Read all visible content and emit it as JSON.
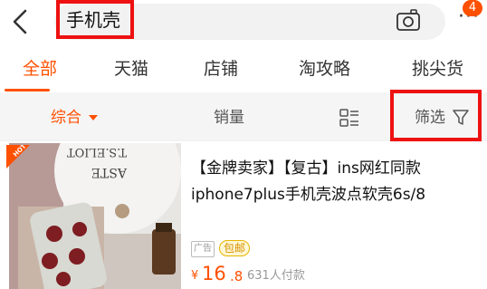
{
  "search": {
    "query": "手机壳"
  },
  "header": {
    "notification_count": "4",
    "more_glyph": "···"
  },
  "tabs": [
    {
      "label": "全部",
      "active": true
    },
    {
      "label": "天猫",
      "active": false
    },
    {
      "label": "店铺",
      "active": false
    },
    {
      "label": "淘攻略",
      "active": false
    },
    {
      "label": "挑尖货",
      "active": false
    }
  ],
  "sortbar": {
    "comprehensive": "综合",
    "sales": "销量",
    "filter": "筛选"
  },
  "product": {
    "hot_badge": "HOT",
    "title": "【金牌卖家】【复古】ins网红同款iphone7plus手机壳波点软壳6s/8",
    "ad_tag": "广告",
    "ship_tag": "包邮",
    "currency": "¥",
    "price_int": "16",
    "price_dec": ".8",
    "sold": "631人付款",
    "image_text_lines": [
      "ASTE",
      "T.S.ELIOT"
    ]
  },
  "colors": {
    "accent": "#ff5000",
    "highlight": "#ee1111"
  }
}
